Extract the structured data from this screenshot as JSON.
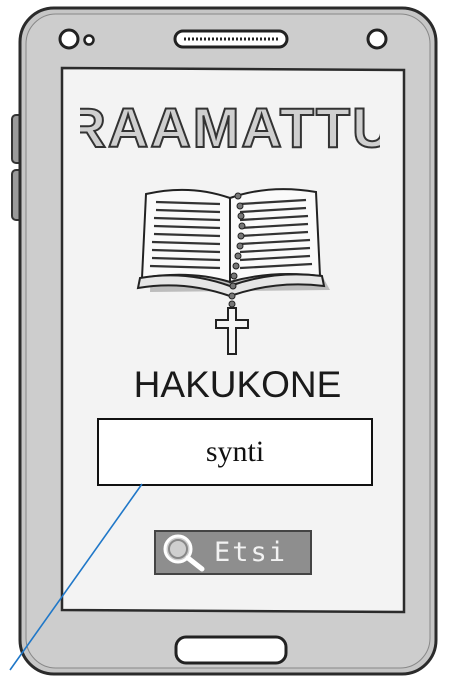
{
  "app": {
    "title": "RAAMATTU",
    "subtitle": "HAKUKONE"
  },
  "search": {
    "value": "synti"
  },
  "button": {
    "label": "Etsi",
    "icon": "magnifier-icon"
  },
  "colors": {
    "phone_outline": "#333333",
    "phone_body": "#c8c8c8",
    "screen_bg": "#efefef",
    "button_bg": "#8e8e8e",
    "annotation": "#1f77c8"
  }
}
